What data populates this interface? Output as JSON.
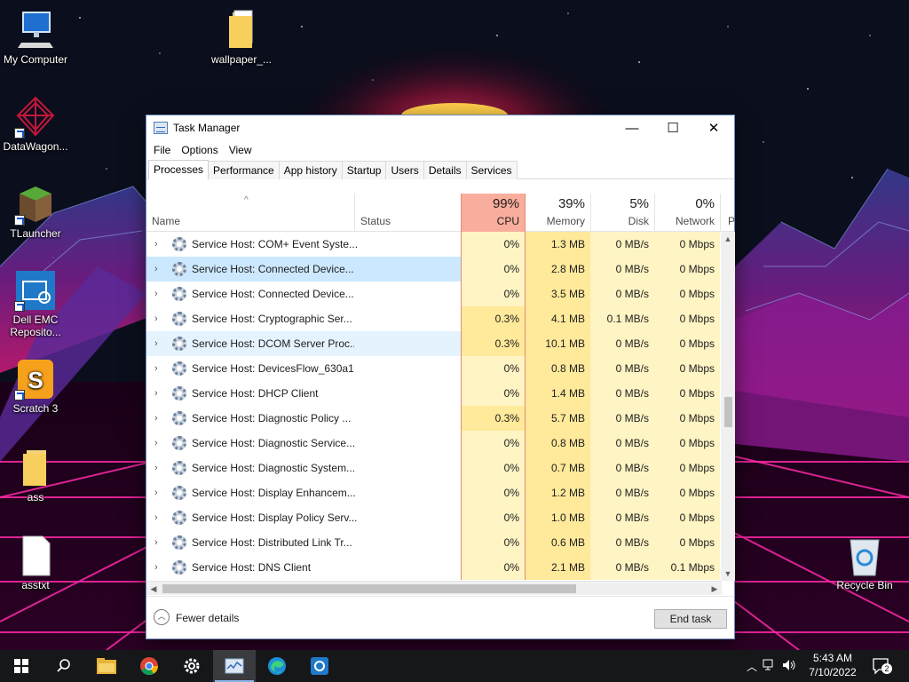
{
  "desktop": {
    "icons": [
      {
        "label": "My Computer"
      },
      {
        "label": "wallpaper_..."
      },
      {
        "label": "DataWagon..."
      },
      {
        "label": "TLauncher"
      },
      {
        "label": "Dell EMC Reposito..."
      },
      {
        "label": "Scratch 3"
      },
      {
        "label": "ass"
      },
      {
        "label": "asstxt"
      },
      {
        "label": "Recycle Bin"
      }
    ]
  },
  "window": {
    "title": "Task Manager",
    "controls": {
      "minimize": "—",
      "maximize": "☐",
      "close": "✕"
    },
    "menu": [
      "File",
      "Options",
      "View"
    ],
    "tabs": [
      "Processes",
      "Performance",
      "App history",
      "Startup",
      "Users",
      "Details",
      "Services"
    ],
    "active_tab": "Processes",
    "columns": {
      "name": "Name",
      "status": "Status",
      "sort_arrow": "^",
      "cpu": {
        "pct": "99%",
        "label": "CPU"
      },
      "memory": {
        "pct": "39%",
        "label": "Memory"
      },
      "disk": {
        "pct": "5%",
        "label": "Disk"
      },
      "network": {
        "pct": "0%",
        "label": "Network"
      },
      "more": "P"
    },
    "rows": [
      {
        "name": "Service Host: COM+ Event Syste...",
        "cpu": "0%",
        "memory": "1.3 MB",
        "disk": "0 MB/s",
        "network": "0 Mbps"
      },
      {
        "name": "Service Host: Connected Device...",
        "cpu": "0%",
        "memory": "2.8 MB",
        "disk": "0 MB/s",
        "network": "0 Mbps",
        "state": "selected"
      },
      {
        "name": "Service Host: Connected Device...",
        "cpu": "0%",
        "memory": "3.5 MB",
        "disk": "0 MB/s",
        "network": "0 Mbps"
      },
      {
        "name": "Service Host: Cryptographic Ser...",
        "cpu": "0.3%",
        "memory": "4.1 MB",
        "disk": "0.1 MB/s",
        "network": "0 Mbps"
      },
      {
        "name": "Service Host: DCOM Server Proc...",
        "cpu": "0.3%",
        "memory": "10.1 MB",
        "disk": "0 MB/s",
        "network": "0 Mbps",
        "state": "hover"
      },
      {
        "name": "Service Host: DevicesFlow_630a1",
        "cpu": "0%",
        "memory": "0.8 MB",
        "disk": "0 MB/s",
        "network": "0 Mbps"
      },
      {
        "name": "Service Host: DHCP Client",
        "cpu": "0%",
        "memory": "1.4 MB",
        "disk": "0 MB/s",
        "network": "0 Mbps"
      },
      {
        "name": "Service Host: Diagnostic Policy ...",
        "cpu": "0.3%",
        "memory": "5.7 MB",
        "disk": "0 MB/s",
        "network": "0 Mbps"
      },
      {
        "name": "Service Host: Diagnostic Service...",
        "cpu": "0%",
        "memory": "0.8 MB",
        "disk": "0 MB/s",
        "network": "0 Mbps"
      },
      {
        "name": "Service Host: Diagnostic System...",
        "cpu": "0%",
        "memory": "0.7 MB",
        "disk": "0 MB/s",
        "network": "0 Mbps"
      },
      {
        "name": "Service Host: Display Enhancem...",
        "cpu": "0%",
        "memory": "1.2 MB",
        "disk": "0 MB/s",
        "network": "0 Mbps"
      },
      {
        "name": "Service Host: Display Policy Serv...",
        "cpu": "0%",
        "memory": "1.0 MB",
        "disk": "0 MB/s",
        "network": "0 Mbps"
      },
      {
        "name": "Service Host: Distributed Link Tr...",
        "cpu": "0%",
        "memory": "0.6 MB",
        "disk": "0 MB/s",
        "network": "0 Mbps"
      },
      {
        "name": "Service Host: DNS Client",
        "cpu": "0%",
        "memory": "2.1 MB",
        "disk": "0 MB/s",
        "network": "0.1 Mbps"
      }
    ],
    "footer": {
      "fewer_details": "Fewer details",
      "end_task": "End task"
    }
  },
  "taskbar": {
    "apps": [
      "start-icon",
      "search-icon",
      "file-explorer-icon",
      "chrome-icon",
      "settings-icon",
      "task-manager-icon",
      "edge-icon",
      "dell-emc-icon"
    ],
    "active_app": "task-manager-icon",
    "clock": {
      "time": "5:43 AM",
      "date": "7/10/2022"
    },
    "notification_count": "2"
  }
}
